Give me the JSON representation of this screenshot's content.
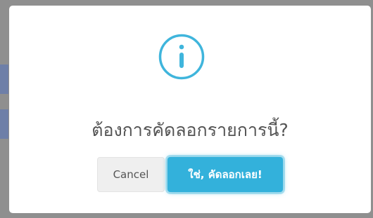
{
  "dialog": {
    "icon": "info-icon",
    "title": "ต้องการคัดลอกรายการนี้?",
    "cancel_label": "Cancel",
    "confirm_label": "ใช่, คัดลอกเลย!"
  },
  "colors": {
    "accent": "#3fb5dc",
    "confirm_bg": "#33b1db",
    "cancel_bg": "#efefef",
    "title_text": "#545454",
    "overlay": "#8f8f8f"
  }
}
